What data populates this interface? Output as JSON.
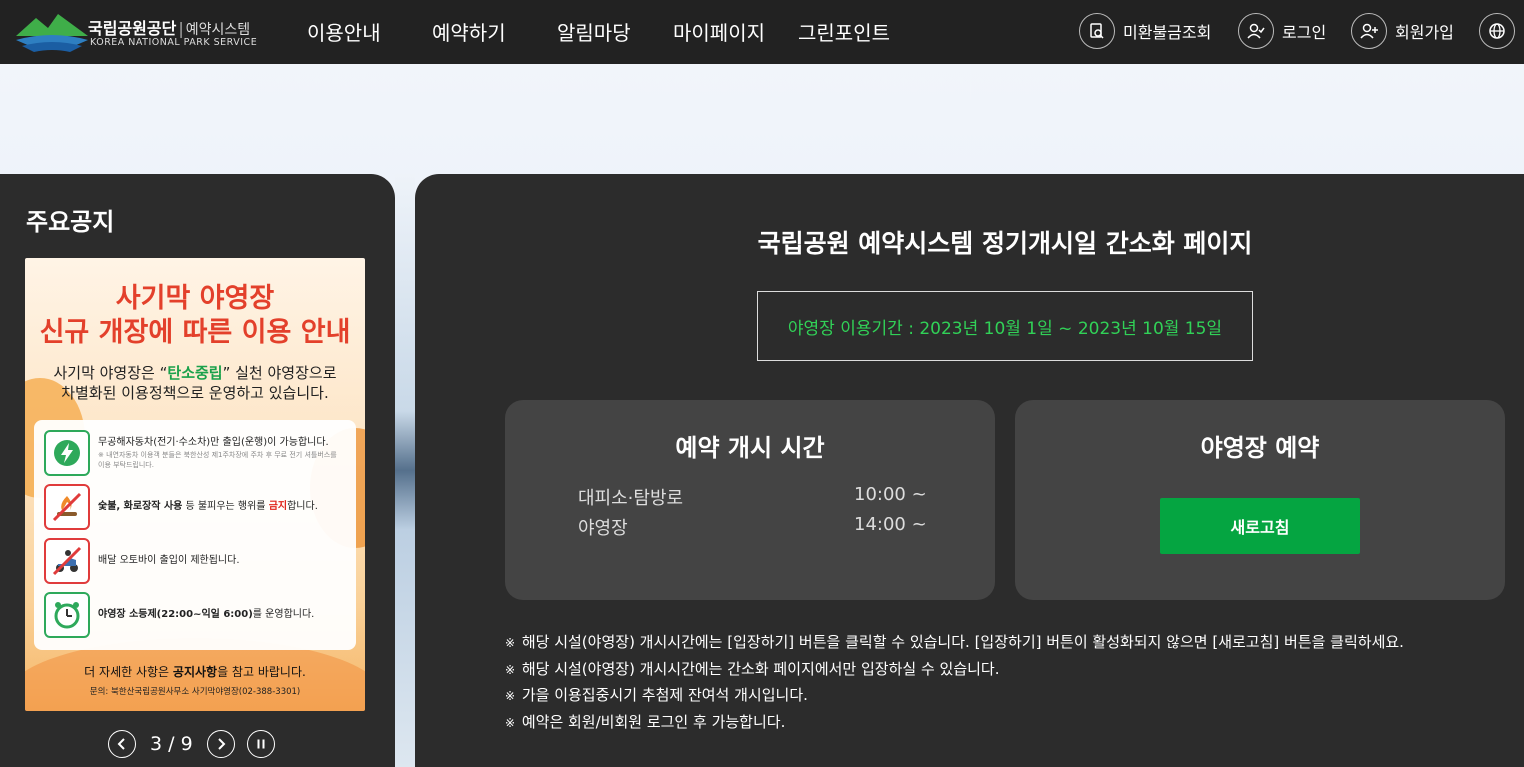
{
  "header": {
    "logo_ko": "국립공원공단",
    "logo_sys": "예약시스템",
    "logo_en": "KOREA NATIONAL PARK SERVICE",
    "nav": [
      "이용안내",
      "예약하기",
      "알림마당",
      "마이페이지",
      "그린포인트"
    ],
    "util": {
      "refund": "미환불금조회",
      "login": "로그인",
      "signup": "회원가입"
    }
  },
  "notice": {
    "title": "주요공지",
    "poster": {
      "line1": "사기막 야영장",
      "line2": "신규 개장에 따른 이용 안내",
      "sub1_pre": "사기막 야영장은 “",
      "sub1_hl": "탄소중립",
      "sub1_post": "” 실천 야영장으로",
      "sub2": "차별화된 이용정책으로 운영하고 있습니다.",
      "rule1": "무공해자동차(전기·수소차)만 출입(운행)이 가능합니다.",
      "rule1_note": "※ 내연자동차 이용객 분들은 북한산성 제1주차장에 주차 후 무료 전기 셔틀버스를 이용 부탁드립니다.",
      "rule2_b": "숯불, 화로장작 사용",
      "rule2_mid": " 등 불피우는 행위를 ",
      "rule2_red": "금지",
      "rule2_end": "합니다.",
      "rule3": "배달 오토바이 출입이 제한됩니다.",
      "rule4_b": "야영장 소등제(22:00~익일 6:00)",
      "rule4_end": "를 운영합니다.",
      "foot_pre": "더 자세한 사항은 ",
      "foot_b": "공지사항",
      "foot_post": "을 참고 바랍니다.",
      "contact": "문의: 북한산국립공원사무소 사기막야영장(02-388-3301)"
    },
    "pager": {
      "current": "3",
      "sep": "/",
      "total": "9"
    }
  },
  "main": {
    "title": "국립공원 예약시스템 정기개시일 간소화 페이지",
    "period": "야영장 이용기간 : 2023년 10월 1일 ~ 2023년 10월 15일",
    "open_card": {
      "title": "예약 개시 시간",
      "rows": [
        {
          "name": "대피소·탐방로",
          "time": "10:00 ~"
        },
        {
          "name": "야영장",
          "time": "14:00 ~"
        }
      ]
    },
    "reserve_card": {
      "title": "야영장 예약",
      "button": "새로고침"
    },
    "notes": [
      "해당 시설(야영장) 개시시간에는 [입장하기] 버튼을 클릭할 수 있습니다. [입장하기] 버튼이 활성화되지 않으면 [새로고침] 버튼을 클릭하세요.",
      "해당 시설(야영장) 개시시간에는 간소화 페이지에서만 입장하실 수 있습니다.",
      "가을 이용집중시기 추첨제 잔여석 개시입니다.",
      "예약은 회원/비회원 로그인 후 가능합니다."
    ],
    "note_mark": "※"
  },
  "colors": {
    "header_bg": "#222222",
    "panel_bg": "#2c2c2c",
    "card_bg": "#444444",
    "accent_green": "#05a541",
    "period_text": "#31d157"
  }
}
